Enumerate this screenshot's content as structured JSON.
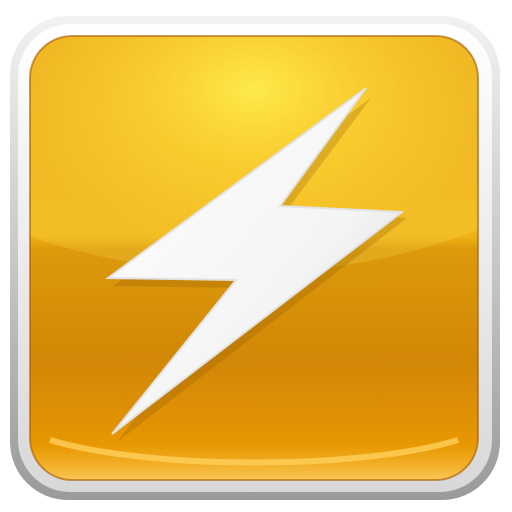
{
  "icon": {
    "name": "lightning-bolt-icon",
    "colors": {
      "frame": "#b9b9b9",
      "frame_highlight": "#f4f4f4",
      "tile_top": "#f7c21a",
      "tile_glow": "#ffe03a",
      "tile_bottom": "#d07a00",
      "tile_edge": "#a85a00",
      "bolt": "#f6f6f6",
      "bolt_shade": "#cfcfcf"
    }
  }
}
